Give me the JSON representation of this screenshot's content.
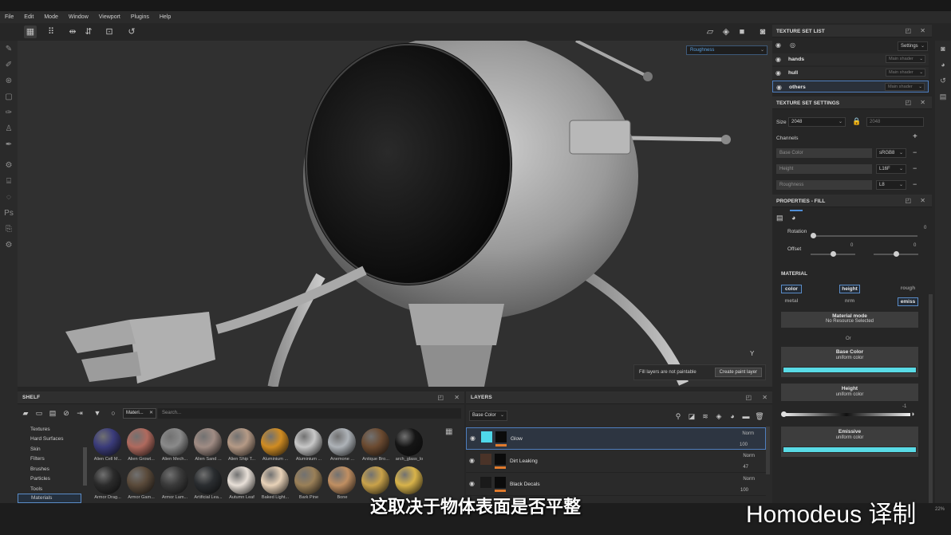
{
  "menu": [
    "File",
    "Edit",
    "Mode",
    "Window",
    "Viewport",
    "Plugins",
    "Help"
  ],
  "viewport": {
    "channel": "Roughness",
    "fill_notice": "Fill layers are not paintable",
    "create_paint_layer": "Create paint layer",
    "axis": "Y"
  },
  "shelf": {
    "title": "SHELF",
    "filter_tag": "Materi...",
    "search_placeholder": "Search...",
    "categories": [
      "Textures",
      "Hard Surfaces",
      "Skin",
      "Filters",
      "Brushes",
      "Particles",
      "Tools",
      "Materials"
    ],
    "selected_category": "Materials",
    "materials_row1": [
      "Alien Cell M...",
      "Alien Growt...",
      "Alien Mech...",
      "Alien Sand ...",
      "Alien Ship T...",
      "Aluminium ...",
      "Aluminium ...",
      "Anemone ...",
      "Antique Bro...",
      "arch_glass_lo"
    ],
    "materials_row2": [
      "Armor Drag...",
      "Armor Gam...",
      "Armor Lam...",
      "Artificial Lea...",
      "Autumn Leaf",
      "Baked Light...",
      "Bark Pine",
      "Bone",
      "",
      ""
    ]
  },
  "layers": {
    "title": "LAYERS",
    "channel": "Base Color",
    "items": [
      {
        "name": "Glow",
        "blend": "Norm",
        "opacity": "100"
      },
      {
        "name": "Dirt Leaking",
        "blend": "Norm",
        "opacity": "47"
      },
      {
        "name": "Black Decals",
        "blend": "Norm",
        "opacity": "100"
      }
    ]
  },
  "texture_set_list": {
    "title": "TEXTURE SET LIST",
    "settings": "Settings",
    "items": [
      {
        "name": "hands",
        "shader": "Main shader"
      },
      {
        "name": "hull",
        "shader": "Main shader"
      },
      {
        "name": "others",
        "shader": "Main shader"
      }
    ]
  },
  "texture_set_settings": {
    "title": "TEXTURE SET SETTINGS",
    "size_label": "Size",
    "size": "2048",
    "size_locked": "2048",
    "channels_label": "Channels",
    "channels": [
      {
        "name": "Base Color",
        "format": "sRGB8"
      },
      {
        "name": "Height",
        "format": "L16F"
      },
      {
        "name": "Roughness",
        "format": "L8"
      }
    ]
  },
  "properties_fill": {
    "title": "PROPERTIES - FILL",
    "rotation_label": "Rotation",
    "rotation_value": "0",
    "offset_label": "Offset",
    "offset_u": "0",
    "offset_v": "0",
    "material_heading": "MATERIAL",
    "chips": [
      "color",
      "height",
      "rough",
      "metal",
      "nrm",
      "emiss"
    ],
    "material_mode": "Material mode",
    "no_resource": "No Resource Selected",
    "or": "Or",
    "base_color": "Base Color",
    "base_color_sub": "uniform color",
    "height": "Height",
    "height_sub": "uniform color",
    "height_value": "-1",
    "emissive": "Emissive",
    "emissive_sub": "uniform color",
    "swatch_color": "#59dbe6"
  },
  "subtitle": "这取决于物体表面是否平整",
  "watermark": "Homodeus 译制",
  "zoom": "22%"
}
